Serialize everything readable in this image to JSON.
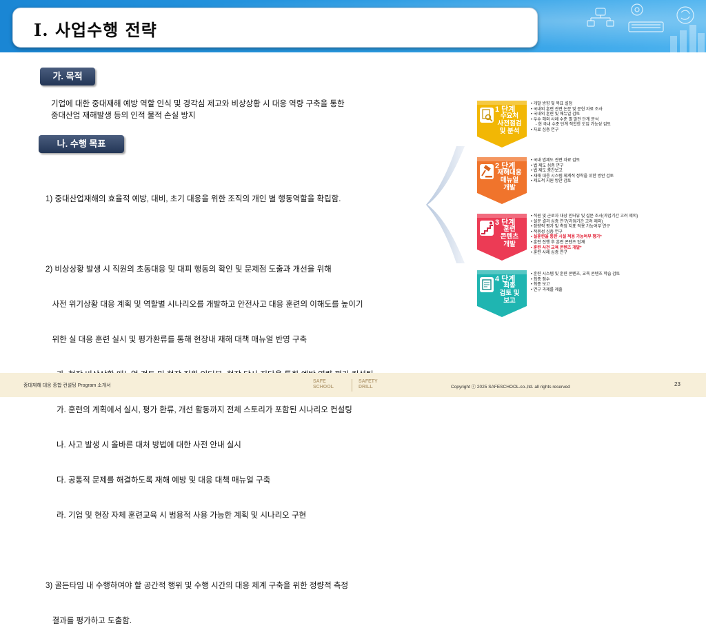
{
  "header": {
    "title": "Ⅰ. 사업수행 전략"
  },
  "section1": {
    "label": "가. 목적",
    "lines": [
      "기업에 대한 중대재해 예방 역할 인식 및 경각심 제고와 비상상황 시 대응 역량 구축을 통한",
      "중대산업 재해발생 등의 인적 물적 손실 방지"
    ]
  },
  "section2": {
    "label": "나. 수행 목표",
    "lines": [
      "1) 중대산업재해의 효율적 예방, 대비, 초기 대응을 위한 조직의 개인 별 행동역할을 확립함.",
      "",
      "2) 비상상황 발생 시 직원의 초동대응 및 대피 행동의 확인 및 문제점 도출과 개선을 위해",
      "   사전 위기상황 대응 계획 및 역할별 시나리오를 개발하고 안전사고 대응 훈련의 이해도를 높이기",
      "   위한 실 대응 훈련 실시 및 평가환류를 통해 현장내 재해 대책 매뉴얼 반영 구축",
      "     가. 현장 비상상황 매뉴얼 검토 및 현장 직원 인터뷰, 현장 답사 진단을 통한 예방 역량 평가 컨설팅",
      "     가. 훈련의 계획에서 실시, 평가 환류, 개선 활동까지 전체 스토리가 포함된 시나리오 컨설팅",
      "     나. 사고 발생 시 올바른 대처 방법에 대한 사전 안내 실시",
      "     다. 공통적 문제를 해결하도록 재해 예방 및 대응 대책 매뉴얼 구축",
      "     라. 기업 및 현장 자체 훈련교육 시 범용적 사용 가능한 계획 및 시나리오 구현",
      "",
      "3) 골든타임 내 수행하여야 할 공간적 행위 및 수행 시간의 대응 체계 구축을 위한 정량적 측정",
      "   결과를 평가하고 도출함."
    ]
  },
  "stages": [
    {
      "num": "1 단계",
      "name": [
        "수요처",
        "사전점검",
        "및 분석"
      ],
      "color": "#f2b705",
      "icon": "magnifier-document-icon",
      "bullets": [
        {
          "text": "•  개발 방향 및 목표 설정",
          "red": false
        },
        {
          "text": "•  국내외 훈련 관련 논문 및 문헌 자료 조사",
          "red": false
        },
        {
          "text": "•  국내외 훈련 및 매뉴얼 검토",
          "red": false
        },
        {
          "text": "•  우수 해외 사례 수준 별 발전 단계 분석",
          "red": false
        },
        {
          "text": "    - 현 국내 수준 단계 적합한 도입 가능성 검토",
          "red": false
        },
        {
          "text": "•  자료 심층 연구",
          "red": false
        }
      ]
    },
    {
      "num": "2 단계",
      "name": [
        "재해대응",
        "매뉴얼",
        "개발"
      ],
      "color": "#f0742c",
      "icon": "gavel-icon",
      "bullets": [
        {
          "text": "•  국내 법제도 관련 자료 검토",
          "red": false
        },
        {
          "text": "•  법 제도 심층 연구",
          "red": false
        },
        {
          "text": "•  법 제도 중간보고",
          "red": false
        },
        {
          "text": "•  재해 대응 시스템 체계적 정착을 위한 방안 검토",
          "red": false
        },
        {
          "text": "•  제도적 지원 방안 검토",
          "red": false
        }
      ]
    },
    {
      "num": "3 단계",
      "name": [
        "훈련",
        "콘텐츠",
        "개발"
      ],
      "color": "#ec3b55",
      "icon": "stairs-icon",
      "bullets": [
        {
          "text": "•  직원 및 근로자 대상 인터뷰 및 설문 조사(과업기간 고려 제외)",
          "red": false
        },
        {
          "text": "•  설문 결과 심층 연구(과업기간 고려 제외)",
          "red": false
        },
        {
          "text": "•  정량적 평가 및 측정 지표 적용 가능여부 연구",
          "red": false
        },
        {
          "text": "•  적용성 심층 연구",
          "red": false
        },
        {
          "text": "•  실훈련을 통한 시설 적용 가능여부 평가*",
          "red": true
        },
        {
          "text": "•  훈련 진행 후 훈련 콘텐츠 탑재",
          "red": false
        },
        {
          "text": "•  훈련 사전 교육 콘텐츠 개발*",
          "red": true
        },
        {
          "text": "•  훈련 사례 심층 연구",
          "red": false
        }
      ]
    },
    {
      "num": "4 단계",
      "name": [
        "최종",
        "검토 및",
        "보고"
      ],
      "color": "#1fb5b1",
      "icon": "report-icon",
      "bullets": [
        {
          "text": "•  훈련 시스템 및 훈련 콘텐츠, 교육 콘텐츠 학습 검토",
          "red": false
        },
        {
          "text": "•  최종 점수",
          "red": false
        },
        {
          "text": "•  최종 보고",
          "red": false
        },
        {
          "text": "•  연구 과제를 제출",
          "red": false
        }
      ]
    }
  ],
  "footer": {
    "left": "중대재해 대응 종합 컨설팅 Program 소개서",
    "logo1": [
      "SAFE",
      "SCHOOL"
    ],
    "logo2": [
      "SAFETY",
      "DRILL"
    ],
    "copyright": "Copyright ⓒ 2025 SAFESCHOOL.co.,ltd. all rights reserved",
    "page": "23"
  }
}
